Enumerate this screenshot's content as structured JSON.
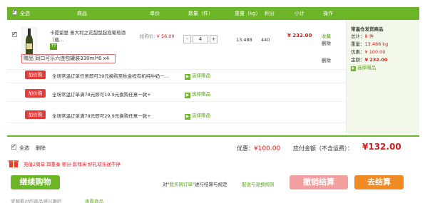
{
  "header": {
    "select_all": "全选",
    "product": "商品",
    "unit_price": "单价",
    "quantity": "数量（件）",
    "weight": "重量（kg）",
    "points": "积分",
    "subtotal": "小计",
    "action": "操作"
  },
  "product": {
    "name_line1": "卡提留里 意大利之花甜型起泡葡萄酒（载...",
    "badge": "77",
    "price_label": "抢购价: ",
    "price": "¥ 56.00",
    "qty_minus": "-",
    "qty": "4",
    "qty_plus": "+",
    "weight": "13.488",
    "points": "440",
    "subtotal": "¥ 232.00",
    "action_fav": "收藏",
    "action_del": "删除",
    "gift_text": "赠品 同口可乐六连包罐装330ml*6 x4",
    "gift_del": "删除"
  },
  "side": {
    "title": "常温仓发货商品",
    "total_label": "总计：",
    "total": "8 件",
    "weight_label": "重量：",
    "weight": "13.488 kg",
    "discount_label": "优惠：",
    "discount": "¥ 100.00",
    "amount_label": "金额：",
    "amount": "¥ 232.00",
    "gift_link": "选择赠品"
  },
  "promos": [
    {
      "tag": "加价购",
      "text": "全场常温订单任意即可39元换购至秋金程有机纯牛奶一...",
      "select": "选择赠品"
    },
    {
      "tag": "加价购",
      "text": "全场常温订单满78元即可19.9元换购任意一款+",
      "select": "选择赠品"
    },
    {
      "tag": "加价购",
      "text": "全场常温订单满78元即可29.9元换购任意一款+",
      "select": "选择赠品"
    }
  ],
  "footer": {
    "select_all": "全选",
    "delete": "删除",
    "discount_label": "优惠：",
    "discount": "¥100.00",
    "payable_label": "应付金额（不含运费）：",
    "payable": "¥132.00",
    "banner": "充值2周年 四重奏 积分 影拜米 好礼欢乐送不停",
    "continue": "继续购物",
    "hint_link": "我买网订单",
    "hint_prefix": "对\"",
    "hint_suffix": "\"进行结算与规定",
    "delivery_link": "配送与退换规则",
    "cancel": "撤销结算",
    "checkout": "去结算",
    "recent": "爱聊看过的商品感兴趣的",
    "recent_tab": "查看商品"
  },
  "colors": {
    "accent": "#6cb526",
    "price": "#d61a1a",
    "cancel": "#f2a0a0",
    "checkout": "#f08a24"
  }
}
